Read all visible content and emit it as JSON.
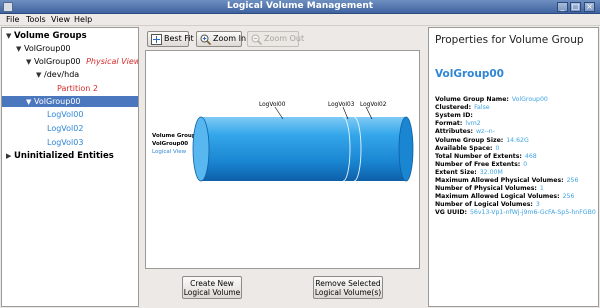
{
  "window": {
    "title": "Logical Volume Management"
  },
  "menu": {
    "file": "File",
    "tools": "Tools",
    "view": "View",
    "help": "Help"
  },
  "tree": {
    "volume_groups": "Volume Groups",
    "vg": "VolGroup00",
    "vg_physical_name": "VolGroup00",
    "physical_view": "Physical View",
    "dev": "/dev/hda",
    "partition": "Partition 2",
    "vg_logical_name": "VolGroup00",
    "lv0": "LogVol00",
    "lv2": "LogVol02",
    "lv3": "LogVol03",
    "uninit": "Uninitialized Entities"
  },
  "toolbar": {
    "best_fit": "Best Fit",
    "zoom_in": "Zoom In",
    "zoom_out": "Zoom Out"
  },
  "canvas": {
    "label_vg": "Volume Group",
    "label_name": "VolGroup00",
    "label_view": "Logical View",
    "seg0": "LogVol00",
    "seg3": "LogVol03",
    "seg2": "LogVol02"
  },
  "buttons": {
    "create_line1": "Create New",
    "create_line2": "Logical Volume",
    "remove_line1": "Remove Selected",
    "remove_line2": "Logical Volume(s)"
  },
  "props": {
    "heading": "Properties for Volume Group",
    "name": "VolGroup00",
    "rows": [
      {
        "k": "Volume Group Name:",
        "v": "VolGroup00"
      },
      {
        "k": "Clustered:",
        "v": "False"
      },
      {
        "k": "System ID:",
        "v": ""
      },
      {
        "k": "Format:",
        "v": "lvm2"
      },
      {
        "k": "Attributes:",
        "v": "wz--n-"
      },
      {
        "k": "Volume Group Size:",
        "v": "14.62G"
      },
      {
        "k": "Available Space:",
        "v": "0"
      },
      {
        "k": "Total Number of Extents:",
        "v": "468"
      },
      {
        "k": "Number of Free Extents:",
        "v": "0"
      },
      {
        "k": "Extent Size:",
        "v": "32.00M"
      },
      {
        "k": "Maximum Allowed Physical Volumes:",
        "v": "256"
      },
      {
        "k": "Number of Physical Volumes:",
        "v": "1"
      },
      {
        "k": "Maximum Allowed Logical Volumes:",
        "v": "256"
      },
      {
        "k": "Number of Logical Volumes:",
        "v": "3"
      },
      {
        "k": "VG UUID:",
        "v": "56v13-Vp1-nfWj-j9m6-GcFA-Sp5-hnFGB0"
      }
    ]
  },
  "colors": {
    "accent": "#4a77bd",
    "value_blue": "#3ea3e3",
    "name_blue": "#2f86d6",
    "cylinder": "#1f8fd6"
  }
}
